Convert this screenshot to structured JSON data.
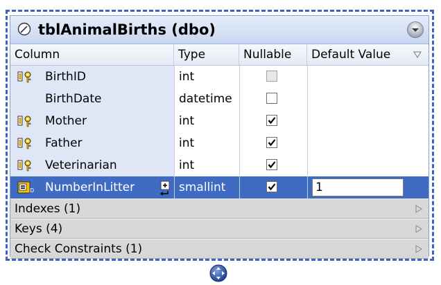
{
  "table": {
    "title": "tblAnimalBirths (dbo)",
    "headers": {
      "column": "Column",
      "type": "Type",
      "nullable": "Nullable",
      "default_value": "Default Value"
    },
    "rows": [
      {
        "name": "BirthID",
        "type": "int",
        "nullable": false,
        "nullable_disabled": true,
        "default": "",
        "key_icon": "foreign-key-icon"
      },
      {
        "name": "BirthDate",
        "type": "datetime",
        "nullable": false,
        "nullable_disabled": false,
        "default": "",
        "key_icon": ""
      },
      {
        "name": "Mother",
        "type": "int",
        "nullable": true,
        "nullable_disabled": false,
        "default": "",
        "key_icon": "foreign-key-icon"
      },
      {
        "name": "Father",
        "type": "int",
        "nullable": true,
        "nullable_disabled": false,
        "default": "",
        "key_icon": "foreign-key-icon"
      },
      {
        "name": "Veterinarian",
        "type": "int",
        "nullable": true,
        "nullable_disabled": false,
        "default": "",
        "key_icon": "foreign-key-icon"
      },
      {
        "name": "NumberInLitter",
        "type": "smallint",
        "nullable": true,
        "nullable_disabled": false,
        "default": "1",
        "key_icon": "check-constraint-icon",
        "selected": true
      }
    ],
    "sections": [
      {
        "label": "Indexes (1)"
      },
      {
        "label": "Keys (4)"
      },
      {
        "label": "Check Constraints (1)"
      }
    ]
  },
  "colors": {
    "selection": "#3f6bc3",
    "frame": "#3b63c4",
    "card_bg": "#d9e3f4"
  }
}
